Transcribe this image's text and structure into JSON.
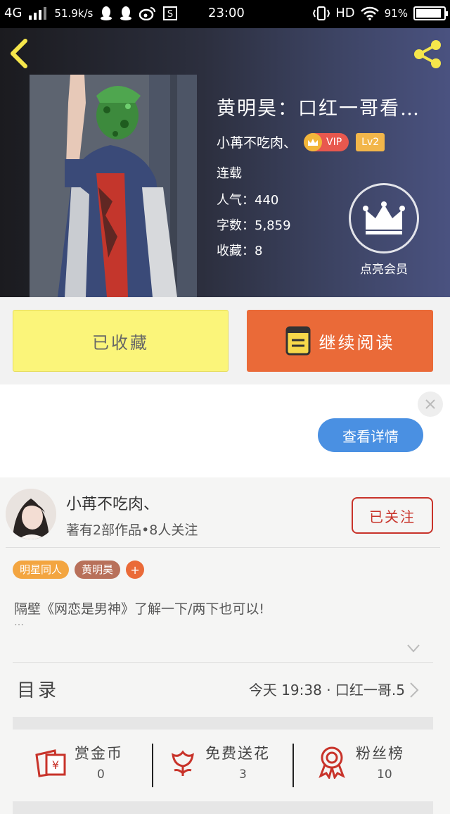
{
  "status_bar": {
    "network": "4G",
    "speed": "51.9k/s",
    "time": "23:00",
    "hd": "HD",
    "battery": "91%",
    "battery_level": 0.91
  },
  "book": {
    "title": "黄明昊：口红一哥看…",
    "author": "小苒不吃肉、",
    "vip_label": "VIP",
    "level_label": "Lv2",
    "status": "连载",
    "popularity_label": "人气：",
    "popularity": "440",
    "words_label": "字数：",
    "words": "5,859",
    "favorites_label": "收藏：",
    "favorites": "8",
    "member_label": "点亮会员"
  },
  "actions": {
    "favorited": "已收藏",
    "continue": "继续阅读"
  },
  "ad": {
    "detail_button": "查看详情"
  },
  "author_card": {
    "name": "小苒不吃肉、",
    "works": "著有2部作品•8人关注",
    "follow": "已关注"
  },
  "tags": [
    {
      "label": "明星同人",
      "color": "#f3a540"
    },
    {
      "label": "黄明昊",
      "color": "#b8705a"
    }
  ],
  "tag_add": "+",
  "intro": "隔壁《网恋是男神》了解一下/两下也可以!",
  "intro_more": "…",
  "toc": {
    "label": "目录",
    "latest": "今天 19:38 · 口红一哥.5"
  },
  "stats": [
    {
      "label": "赏金币",
      "value": "0",
      "icon": "red-envelope-icon"
    },
    {
      "label": "免费送花",
      "value": "3",
      "icon": "flower-icon"
    },
    {
      "label": "粉丝榜",
      "value": "10",
      "icon": "medal-icon"
    }
  ]
}
